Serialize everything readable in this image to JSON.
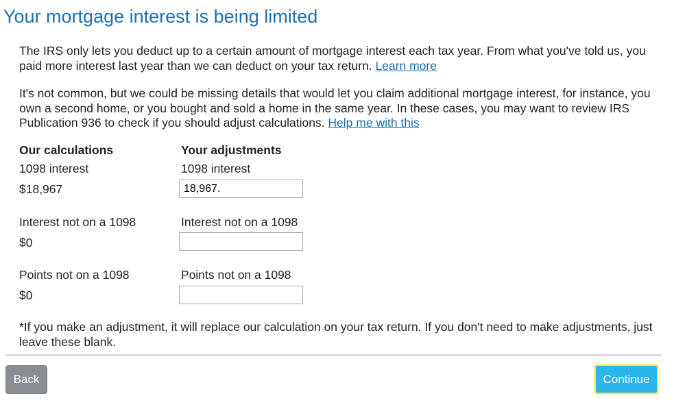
{
  "header": {
    "title": "Your mortgage interest is being limited"
  },
  "intro": {
    "text": "The IRS only lets you deduct up to a certain amount of mortgage interest each tax year. From what you've told us, you paid more interest last year than we can deduct on your tax return. ",
    "link": "Learn more"
  },
  "details": {
    "text": "It's not common, but we could be missing details that would let you claim additional mortgage interest, for instance, you own a second home, or you bought and sold a home in the same year. In these cases, you may want to review IRS Publication 936 to check if you should adjust calculations. ",
    "link": "Help me with this"
  },
  "columns": {
    "calculations_heading": "Our calculations",
    "adjustments_heading": "Your adjustments"
  },
  "rows": [
    {
      "label": "1098 interest",
      "calculated": "$18,967",
      "adjustment_label": "1098 interest",
      "adjustment_value": "18,967."
    },
    {
      "label": "Interest not on a 1098",
      "calculated": "$0",
      "adjustment_label": "Interest not on a 1098",
      "adjustment_value": ""
    },
    {
      "label": "Points not on a 1098",
      "calculated": "$0",
      "adjustment_label": "Points not on a 1098",
      "adjustment_value": ""
    }
  ],
  "footnote": {
    "text": "*If you make an adjustment, it will replace our calculation on your tax return. If you don't need to make adjustments, just leave these blank."
  },
  "buttons": {
    "back": "Back",
    "continue": "Continue"
  }
}
